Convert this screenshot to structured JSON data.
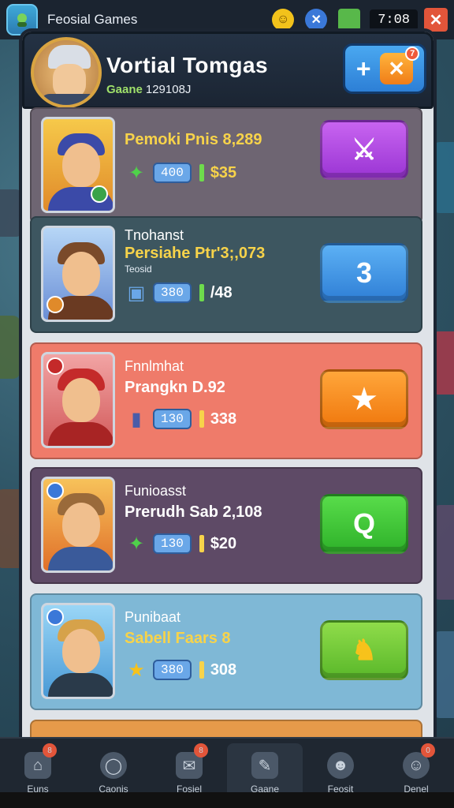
{
  "status_bar": {
    "app_title": "Feosial Games",
    "time": "7:08",
    "icons": [
      "app-icon",
      "emoji-icon",
      "shield-x-icon",
      "cube-icon",
      "close-icon"
    ]
  },
  "header": {
    "title": "Vortial Tomgas",
    "subtitle_label": "Gaane",
    "subtitle_value": "129108J",
    "badge": "7"
  },
  "cards": [
    {
      "label": "",
      "name": "Pemoki Pnis 8,289",
      "sub": "",
      "pill": "400",
      "value": "$35",
      "bg": "#6e6572",
      "action_icon": "sword-icon",
      "action_color": "#b94de8"
    },
    {
      "label": "Tnohanst",
      "name": "Persiahe Ptr'3;,073",
      "sub": "Teosid",
      "pill": "380",
      "value": "/48",
      "bg": "#3d5660",
      "action_icon": "number-3-icon",
      "action_text": "3",
      "action_color": "#3f95e8"
    },
    {
      "label": "Fnnlmhat",
      "name": "Prangkn D.92",
      "sub": "",
      "pill": "130",
      "value": "338",
      "bg": "#ef7b6a",
      "action_icon": "star-icon",
      "action_color": "#f08a1a"
    },
    {
      "label": "Funioasst",
      "name": "Prerudh Sab 2,108",
      "sub": "",
      "pill": "130",
      "value": "$20",
      "bg": "#5e4a66",
      "action_icon": "search-icon",
      "action_color": "#3ecb37"
    },
    {
      "label": "Punibaat",
      "name": "Sabell Faars 8",
      "sub": "",
      "pill": "380",
      "value": "308",
      "bg": "#7fb8d6",
      "action_icon": "puzzle-icon",
      "action_color": "#70cf3a"
    }
  ],
  "nav": [
    {
      "label": "Euns",
      "badge": "8"
    },
    {
      "label": "Caonis",
      "badge": ""
    },
    {
      "label": "Fosiel",
      "badge": "8"
    },
    {
      "label": "Gaane",
      "badge": ""
    },
    {
      "label": "Feosit",
      "badge": ""
    },
    {
      "label": "Denel",
      "badge": "0"
    }
  ],
  "colors": {
    "accent": "#3f95e8",
    "panel": "#dfe3e8"
  }
}
